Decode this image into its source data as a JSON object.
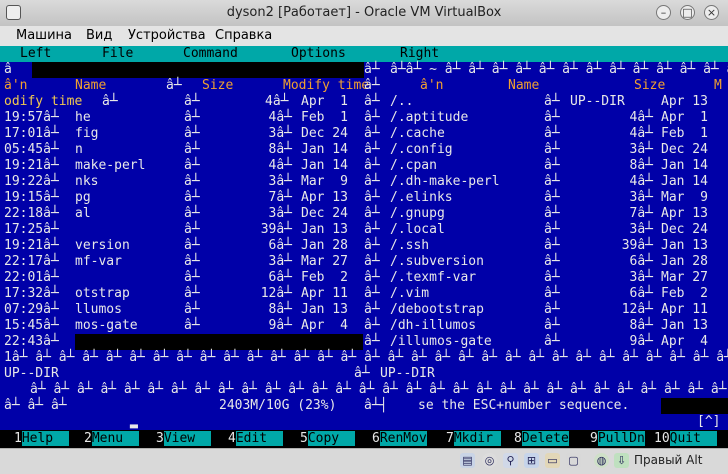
{
  "window": {
    "title": "dyson2 [Работает] - Oracle VM VirtualBox"
  },
  "vbox_menu": [
    "Машина",
    "Вид",
    "Устройства",
    "Справка"
  ],
  "mc_menu": [
    "Left",
    "File",
    "Command",
    "Options",
    "Right"
  ],
  "left_panel": {
    "header_top": "â",
    "header_cols": {
      "n": "â'n",
      "name": "Name",
      "sep": "â┴",
      "size": "Size",
      "modify": "Modify time"
    },
    "header2": "odify time",
    "rows": [
      {
        "time": "19:57â┴",
        "name": "he",
        "sep": "â┴",
        "size": "4â┴",
        "date": "Feb  1"
      },
      {
        "time": "17:01â┴",
        "name": "fig",
        "sep": "â┴",
        "size": "3â┴",
        "date": "Dec 24"
      },
      {
        "time": "05:45â┴",
        "name": "n",
        "sep": "â┴",
        "size": "8â┴",
        "date": "Jan 14"
      },
      {
        "time": "19:21â┴",
        "name": "make-perl",
        "sep": "â┴",
        "size": "4â┴",
        "date": "Jan 14"
      },
      {
        "time": "19:22â┴",
        "name": "nks",
        "sep": "â┴",
        "size": "3â┴",
        "date": "Mar  9"
      },
      {
        "time": "19:15â┴",
        "name": "pg",
        "sep": "â┴",
        "size": "7â┴",
        "date": "Apr 13"
      },
      {
        "time": "22:18â┴",
        "name": "al",
        "sep": "â┴",
        "size": "3â┴",
        "date": "Dec 24"
      },
      {
        "time": "17:25â┴",
        "name": "",
        "sep": "â┴",
        "size": "39â┴",
        "date": "Jan 13"
      },
      {
        "time": "19:21â┴",
        "name": "version",
        "sep": "â┴",
        "size": "6â┴",
        "date": "Jan 28"
      },
      {
        "time": "22:17â┴",
        "name": "mf-var",
        "sep": "â┴",
        "size": "3â┴",
        "date": "Mar 27"
      },
      {
        "time": "22:01â┴",
        "name": "",
        "sep": "â┴",
        "size": "6â┴",
        "date": "Feb  2"
      },
      {
        "time": "17:32â┴",
        "name": "otstrap",
        "sep": "â┴",
        "size": "12â┴",
        "date": "Apr 11"
      },
      {
        "time": "07:29â┴",
        "name": "llumos",
        "sep": "â┴",
        "size": "8â┴",
        "date": "Jan 13"
      },
      {
        "time": "15:45â┴",
        "name": "mos-gate",
        "sep": "â┴",
        "size": "9â┴",
        "date": "Apr  4"
      },
      {
        "time": "22:43â┴",
        "name": "",
        "sep": "",
        "size": "",
        "date": ""
      }
    ],
    "first_row": {
      "time": "odify time",
      "sep": "â┴",
      "size": "4â┴",
      "date": "Apr  1"
    },
    "footer": "UP--DIR",
    "free": "2403M/10G (23%)"
  },
  "right_panel": {
    "header_top": "â┴â┴ ~ â┴ â┴ â┴ â┴ â┴ â┴ â┴ â┴ â┴ â┴ â┴ â┴ â┴ â┴",
    "header_cols": {
      "n": "â'n",
      "name": "Name",
      "size": "Size",
      "modify": "M"
    },
    "rows": [
      {
        "name": "/..",
        "size": "UP--DIR",
        "date": "Apr 13"
      },
      {
        "name": "/.aptitude",
        "size": "4â┴",
        "date": "Apr  1"
      },
      {
        "name": "/.cache",
        "size": "4â┴",
        "date": "Feb  1"
      },
      {
        "name": "/.config",
        "size": "3â┴",
        "date": "Dec 24"
      },
      {
        "name": "/.cpan",
        "size": "8â┴",
        "date": "Jan 14"
      },
      {
        "name": "/.dh-make-perl",
        "size": "4â┴",
        "date": "Jan 14"
      },
      {
        "name": "/.elinks",
        "size": "3â┴",
        "date": "Mar  9"
      },
      {
        "name": "/.gnupg",
        "size": "7â┴",
        "date": "Apr 13"
      },
      {
        "name": "/.local",
        "size": "3â┴",
        "date": "Dec 24"
      },
      {
        "name": "/.ssh",
        "size": "39â┴",
        "date": "Jan 13"
      },
      {
        "name": "/.subversion",
        "size": "6â┴",
        "date": "Jan 28"
      },
      {
        "name": "/.texmf-var",
        "size": "3â┴",
        "date": "Mar 27"
      },
      {
        "name": "/.vim",
        "size": "6â┴",
        "date": "Feb  2"
      },
      {
        "name": "/debootstrap",
        "size": "12â┴",
        "date": "Apr 11"
      },
      {
        "name": "/dh-illumos",
        "size": "8â┴",
        "date": "Jan 13"
      },
      {
        "name": "/illumos-gate",
        "size": "9â┴",
        "date": "Apr  4"
      }
    ],
    "footer": "UP--DIR"
  },
  "hint": "se the ESC+number sequence.",
  "prompt_right": "[^]",
  "fkeys": [
    {
      "n": "1",
      "label": "Help"
    },
    {
      "n": "2",
      "label": "Menu"
    },
    {
      "n": "3",
      "label": "View"
    },
    {
      "n": "4",
      "label": "Edit"
    },
    {
      "n": "5",
      "label": "Copy"
    },
    {
      "n": "6",
      "label": "RenMov"
    },
    {
      "n": "7",
      "label": "Mkdir"
    },
    {
      "n": "8",
      "label": "Delete"
    },
    {
      "n": "9",
      "label": "PullDn"
    },
    {
      "n": "10",
      "label": "Quit"
    }
  ],
  "status": {
    "host_key": "Правый Alt"
  },
  "icons": [
    "hdd-icon",
    "cd-icon",
    "usb-icon",
    "network-icon",
    "shared-folder-icon",
    "display-icon",
    "capture-icon",
    "mouse-icon",
    "host-key-icon"
  ]
}
